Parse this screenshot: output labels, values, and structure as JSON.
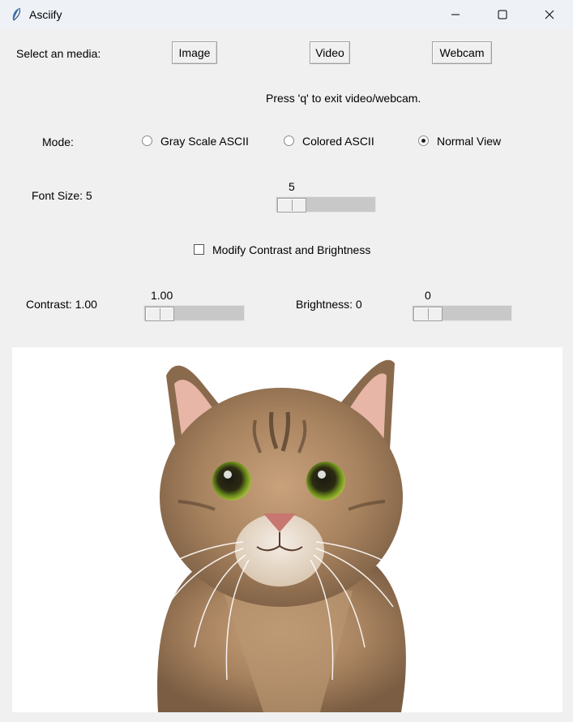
{
  "window": {
    "title": "Asciify",
    "icon": "feather-icon",
    "controls": [
      "minimize-icon",
      "maximize-icon",
      "close-icon"
    ]
  },
  "media": {
    "label": "Select an media:",
    "buttons": [
      "Image",
      "Video",
      "Webcam"
    ]
  },
  "hint": "Press 'q' to exit video/webcam.",
  "mode": {
    "label": "Mode:",
    "options": [
      "Gray Scale ASCII",
      "Colored ASCII",
      "Normal View"
    ],
    "selected": "Normal View"
  },
  "font_size": {
    "label": "Font Size: 5",
    "value": "5",
    "level": 0
  },
  "modify_checkbox": {
    "label": "Modify Contrast and Brightness",
    "checked": false
  },
  "contrast": {
    "label": "Contrast: 1.00",
    "value": "1.00",
    "level": 0
  },
  "brightness": {
    "label": "Brightness: 0",
    "value": "0",
    "level": 0
  },
  "preview": {
    "content": "cat photo"
  },
  "colors": {
    "window_bg": "#f0f0f0",
    "titlebar_bg": "#eef2f7",
    "preview_bg": "#ffffff"
  }
}
